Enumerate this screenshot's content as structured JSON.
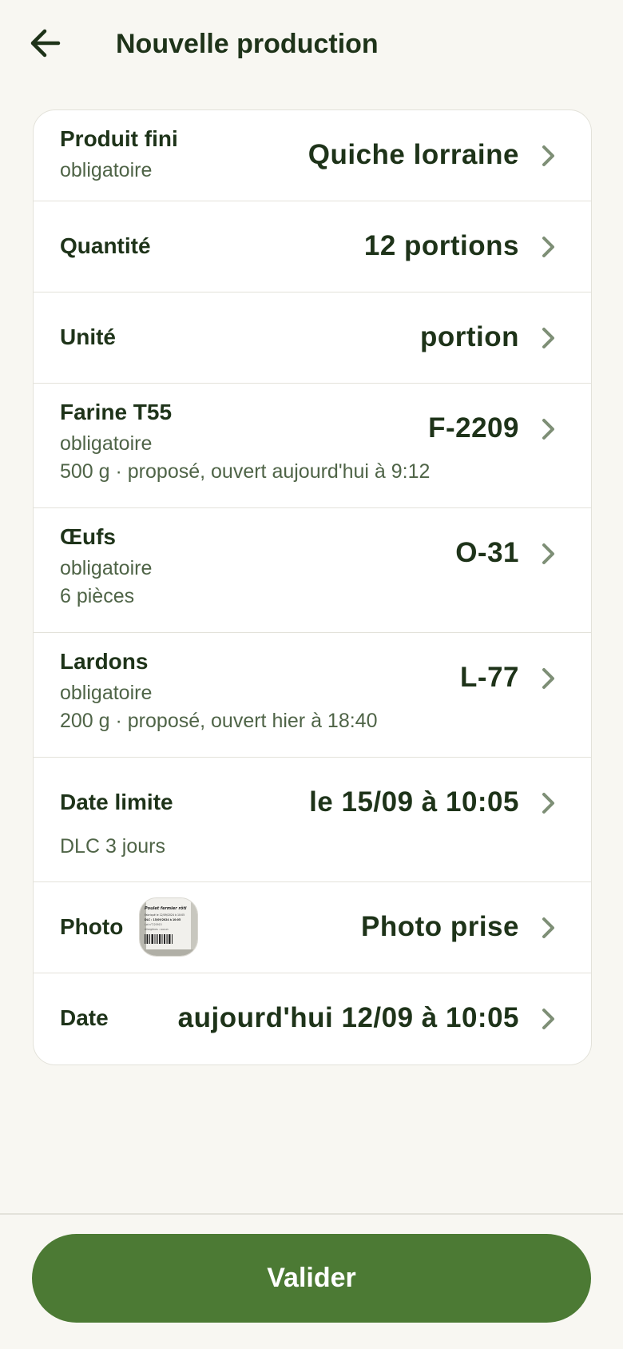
{
  "header": {
    "title": "Nouvelle production",
    "back_icon": "arrow-left-icon"
  },
  "form": {
    "produit": {
      "label": "Produit fini",
      "sub": "obligatoire",
      "value": "Quiche lorraine"
    },
    "quantite": {
      "label": "Quantité",
      "value": "12 portions"
    },
    "unite": {
      "label": "Unité",
      "value": "portion"
    },
    "farine": {
      "label": "Farine T55",
      "sub": "obligatoire",
      "detail": "500 g · proposé, ouvert aujourd'hui à 9:12",
      "value": "F-2209"
    },
    "oeufs": {
      "label": "Œufs",
      "sub": "obligatoire",
      "detail": "6 pièces",
      "value": "O-31"
    },
    "lardons": {
      "label": "Lardons",
      "sub": "obligatoire",
      "detail": "200 g · proposé, ouvert hier à 18:40",
      "value": "L-77"
    },
    "date_limite": {
      "label": "Date limite",
      "detail": "DLC 3 jours",
      "value": "le 15/09 à 10:05"
    },
    "photo": {
      "label": "Photo",
      "value": "Photo prise",
      "thumbnail_text": [
        "Poulet fermier rôti",
        "Fabriqué le 12/09/2024 à 10:05",
        "DLC : 15/09/2024 à 10:05",
        "Lot n°220915",
        "Allergènes : aucun"
      ]
    },
    "date": {
      "label": "Date",
      "value": "aujourd'hui 12/09 à 10:05"
    }
  },
  "footer": {
    "validate_label": "Valider"
  },
  "colors": {
    "background": "#f8f7f2",
    "primary": "#4c7a34",
    "text": "#1e3319",
    "muted": "#4f6447",
    "chevron": "#7e8f76"
  }
}
